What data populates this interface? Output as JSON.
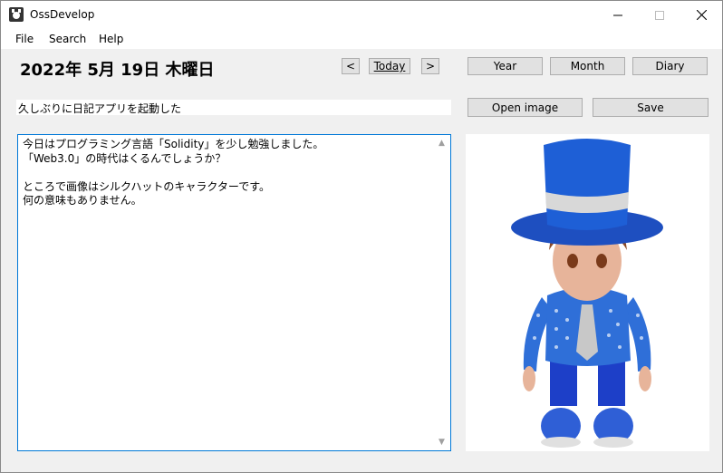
{
  "window": {
    "title": "OssDevelop"
  },
  "menu": [
    "File",
    "Search",
    "Help"
  ],
  "date": "2022年 5月 19日 木曜日",
  "nav": {
    "prev": "<",
    "today": "Today",
    "next": ">"
  },
  "views": {
    "year": "Year",
    "month": "Month",
    "diary": "Diary"
  },
  "actions": {
    "open_image": "Open image",
    "save": "Save"
  },
  "subject": "久しぶりに日記アプリを起動した",
  "body": "今日はプログラミング言語「Solidity」を少し勉強しました。\n「Web3.0」の時代はくるんでしょうか？\n\nところで画像はシルクハットのキャラクターです。\n何の意味もありません。",
  "colors": {
    "accent": "#0078d7",
    "button": "#e1e1e1",
    "hat": "#1e5fd6",
    "shirt": "#2f6fd8"
  }
}
